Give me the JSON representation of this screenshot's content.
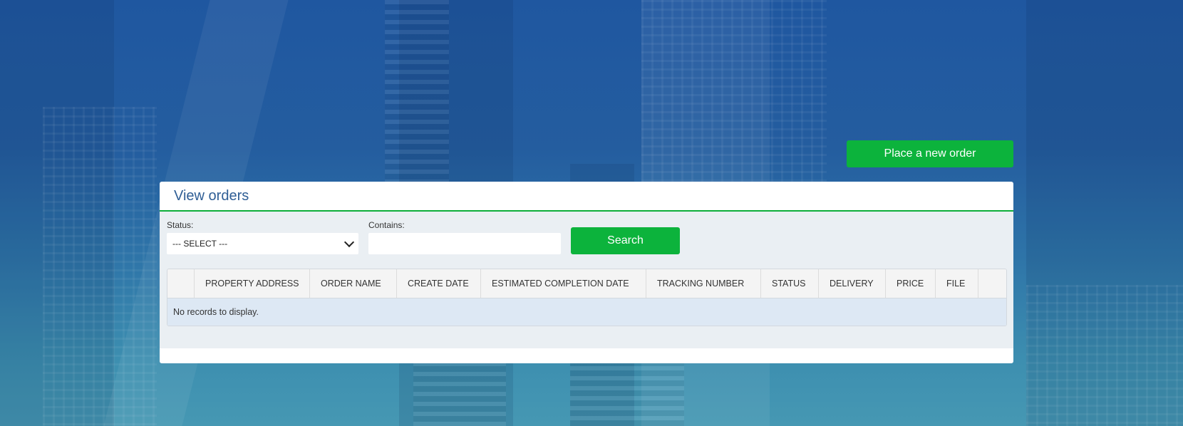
{
  "actions": {
    "new_order_label": "Place a new order"
  },
  "panel": {
    "title": "View orders"
  },
  "filters": {
    "status_label": "Status:",
    "status_value": "--- SELECT ---",
    "contains_label": "Contains:",
    "contains_value": "",
    "search_label": "Search"
  },
  "table": {
    "columns": [
      "",
      "PROPERTY ADDRESS",
      "ORDER NAME",
      "CREATE DATE",
      "ESTIMATED COMPLETION DATE",
      "TRACKING NUMBER",
      "STATUS",
      "DELIVERY",
      "PRICE",
      "FILE",
      ""
    ],
    "empty_message": "No records to display."
  },
  "colors": {
    "accent_green": "#0cb33c",
    "title_blue": "#2f5e95",
    "background_blue": "#245d9f"
  }
}
